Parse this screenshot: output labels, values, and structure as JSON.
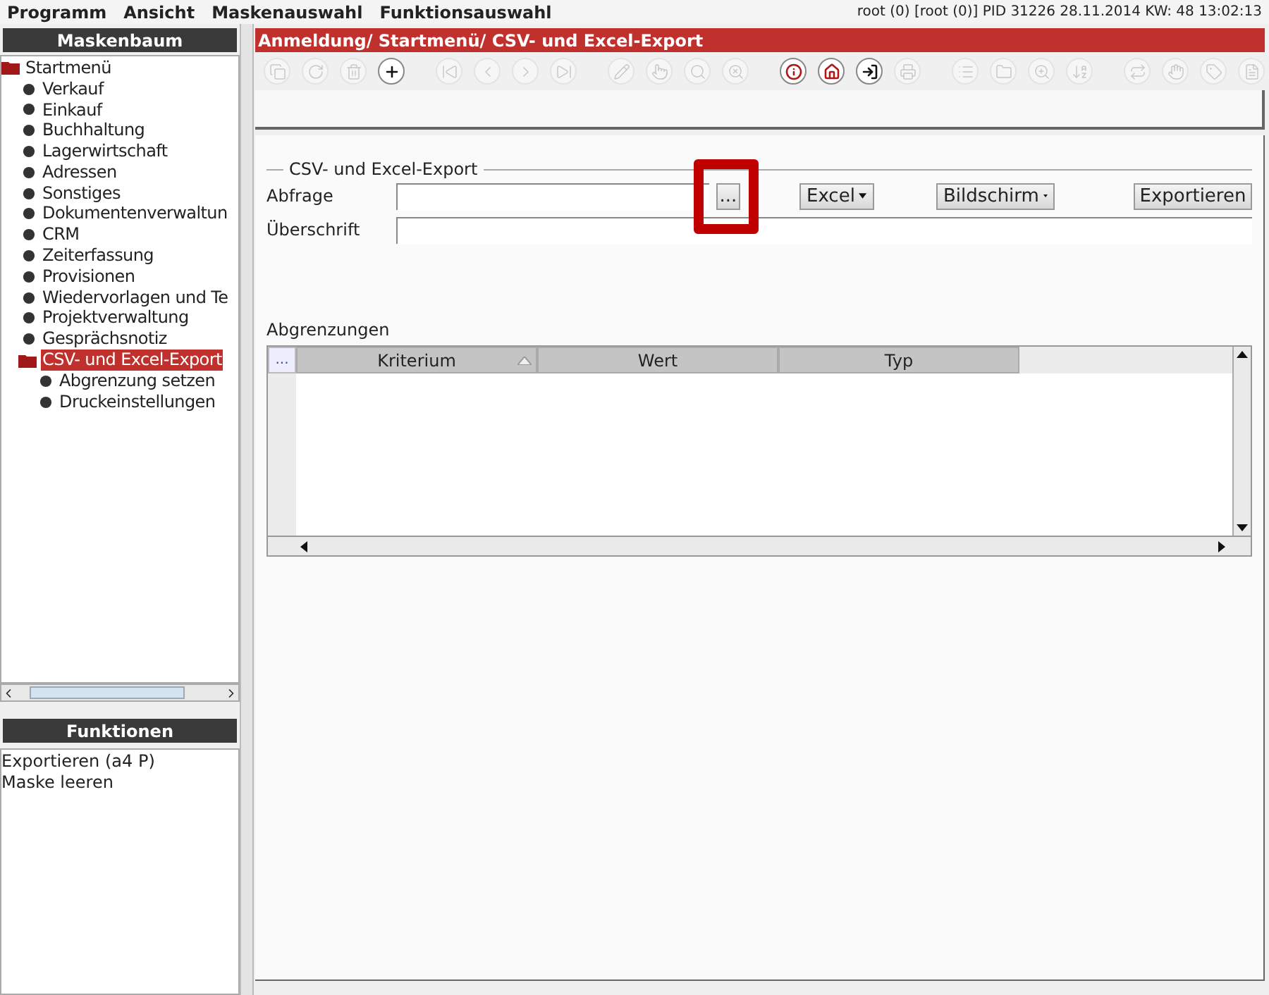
{
  "menu_bar": [
    "Programm",
    "Ansicht",
    "Maskenauswahl",
    "Funktionsauswahl"
  ],
  "status_text": "root (0) [root (0)] PID 31226  28.11.2014 KW: 48  13:02:13",
  "left_panel": {
    "title": "Maskenbaum",
    "tree": [
      {
        "label": "Startmenü",
        "kind": "folder",
        "selected": false,
        "children": [
          {
            "label": "Verkauf",
            "kind": "leaf",
            "selected": false
          },
          {
            "label": "Einkauf",
            "kind": "leaf",
            "selected": false
          },
          {
            "label": "Buchhaltung",
            "kind": "leaf",
            "selected": false
          },
          {
            "label": "Lagerwirtschaft",
            "kind": "leaf",
            "selected": false
          },
          {
            "label": "Adressen",
            "kind": "leaf",
            "selected": false
          },
          {
            "label": "Sonstiges",
            "kind": "leaf",
            "selected": false
          },
          {
            "label": "Dokumentenverwaltun",
            "kind": "leaf",
            "selected": false
          },
          {
            "label": "CRM",
            "kind": "leaf",
            "selected": false
          },
          {
            "label": "Zeiterfassung",
            "kind": "leaf",
            "selected": false
          },
          {
            "label": "Provisionen",
            "kind": "leaf",
            "selected": false
          },
          {
            "label": "Wiedervorlagen und Te",
            "kind": "leaf",
            "selected": false
          },
          {
            "label": "Projektverwaltung",
            "kind": "leaf",
            "selected": false
          },
          {
            "label": "Gesprächsnotiz",
            "kind": "leaf",
            "selected": false
          },
          {
            "label": "CSV- und Excel-Export",
            "kind": "folder",
            "selected": true,
            "children": [
              {
                "label": "Abgrenzung setzen",
                "kind": "leaf",
                "selected": false
              },
              {
                "label": "Druckeinstellungen",
                "kind": "leaf",
                "selected": false
              }
            ]
          }
        ]
      }
    ]
  },
  "functions_panel": {
    "title": "Funktionen",
    "items": [
      "Exportieren (a4 P)",
      "Maske leeren"
    ]
  },
  "breadcrumb": "Anmeldung/ Startmenü/ CSV- und Excel-Export",
  "toolbar_groups": [
    [
      {
        "enabled": false
      },
      {
        "enabled": false
      },
      {
        "enabled": false
      },
      {
        "enabled": true
      }
    ],
    [
      {
        "enabled": false
      },
      {
        "enabled": false
      },
      {
        "enabled": false
      },
      {
        "enabled": false
      }
    ],
    [
      {
        "enabled": false
      },
      {
        "enabled": false
      },
      {
        "enabled": false
      },
      {
        "enabled": false
      }
    ],
    [
      {
        "enabled": true
      },
      {
        "enabled": true
      },
      {
        "enabled": true
      },
      {
        "enabled": false
      }
    ],
    [
      {
        "enabled": false
      },
      {
        "enabled": false
      },
      {
        "enabled": false
      },
      {
        "enabled": false
      }
    ],
    [
      {
        "enabled": false
      },
      {
        "enabled": false
      },
      {
        "enabled": false
      },
      {
        "enabled": false
      }
    ]
  ],
  "form": {
    "title": "CSV- und Excel-Export",
    "fields": [
      {
        "label": "Abfrage",
        "browse_button": "..."
      },
      {
        "label": "Überschrift"
      }
    ],
    "format_dropdown": "Excel",
    "target_dropdown": "Bildschirm",
    "export_button": "Exportieren",
    "highlighted": true
  },
  "restrictions": {
    "title": "Abgrenzungen",
    "corner_button": "...",
    "columns": [
      {
        "label": "Kriterium",
        "sorted": true
      },
      {
        "label": "Wert",
        "sorted": false
      },
      {
        "label": "Typ",
        "sorted": false
      }
    ]
  }
}
